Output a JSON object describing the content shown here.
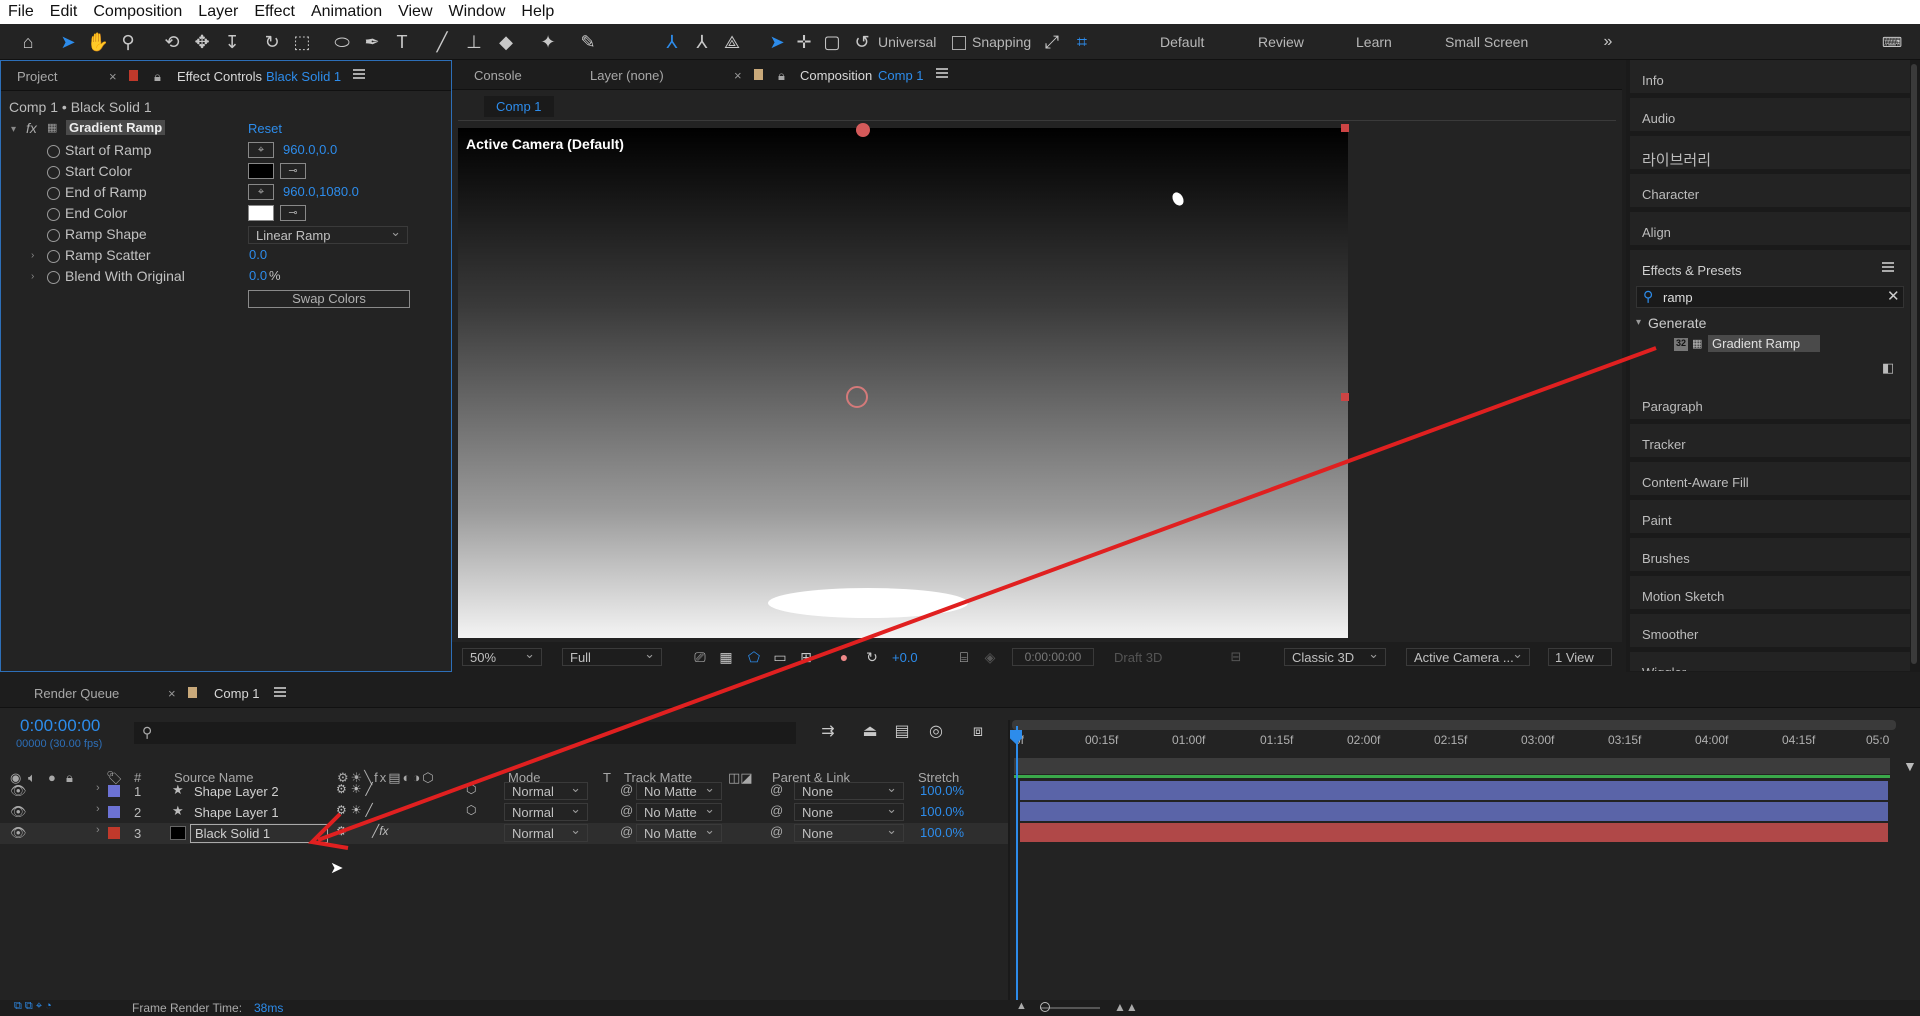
{
  "menu": [
    "File",
    "Edit",
    "Composition",
    "Layer",
    "Effect",
    "Animation",
    "View",
    "Window",
    "Help"
  ],
  "toolbar": {
    "axis_mode": "Universal",
    "snapping": "Snapping",
    "workspaces": [
      "Default",
      "Review",
      "Learn",
      "Small Screen"
    ]
  },
  "left_panel": {
    "tab_project": "Project",
    "tab_effect_controls": "Effect Controls",
    "tab_effect_target": "Black Solid 1",
    "header": "Comp 1 • Black Solid 1",
    "effect_name": "Gradient Ramp",
    "reset": "Reset",
    "fx": "fx",
    "props": [
      {
        "label": "Start of Ramp",
        "value": "960.0,0.0"
      },
      {
        "label": "Start Color",
        "value": ""
      },
      {
        "label": "End of Ramp",
        "value": "960.0,1080.0"
      },
      {
        "label": "End Color",
        "value": ""
      },
      {
        "label": "Ramp Shape",
        "value": "Linear Ramp"
      },
      {
        "label": "Ramp Scatter",
        "value": "0.0"
      },
      {
        "label": "Blend With Original",
        "value": "0.0",
        "unit": "%"
      }
    ],
    "swap": "Swap Colors",
    "colors": {
      "start": "#000000",
      "end": "#ffffff"
    }
  },
  "viewer": {
    "tab_console": "Console",
    "tab_layer": "Layer (none)",
    "tab_composition": "Composition",
    "tab_comp_name": "Comp 1",
    "breadcrumb": "Comp 1",
    "camera_label": "Active Camera (Default)",
    "zoom": "50%",
    "resolution": "Full",
    "exposure": "+0.0",
    "timecode": "0:00:00:00",
    "draft": "Draft 3D",
    "renderer": "Classic 3D",
    "view_camera": "Active Camera ...",
    "views": "1 View"
  },
  "right_panel": {
    "items_top": [
      "Info",
      "Audio",
      "라이브러리",
      "Character",
      "Align"
    ],
    "effects_presets": "Effects & Presets",
    "search_value": "ramp",
    "category": "Generate",
    "result": "Gradient Ramp",
    "result_badge": "32",
    "items_bottom": [
      "Paragraph",
      "Tracker",
      "Content-Aware Fill",
      "Paint",
      "Brushes",
      "Motion Sketch",
      "Smoother",
      "Wiggler"
    ]
  },
  "timeline": {
    "tab_render_queue": "Render Queue",
    "tab_comp": "Comp 1",
    "timecode": "0:00:00:00",
    "fps": "00000 (30.00 fps)",
    "columns": {
      "num": "#",
      "source": "Source Name",
      "mode": "Mode",
      "t": "T",
      "track_matte": "Track Matte",
      "parent": "Parent & Link",
      "stretch": "Stretch"
    },
    "layers": [
      {
        "num": "1",
        "name": "Shape Layer 2",
        "mode": "Normal",
        "matte": "No Matte",
        "parent": "None",
        "stretch": "100.0%",
        "color": "#6c72d4",
        "bar": "#5a64a8"
      },
      {
        "num": "2",
        "name": "Shape Layer 1",
        "mode": "Normal",
        "matte": "No Matte",
        "parent": "None",
        "stretch": "100.0%",
        "color": "#6c72d4",
        "bar": "#5a64a8"
      },
      {
        "num": "3",
        "name": "Black Solid 1",
        "mode": "Normal",
        "matte": "No Matte",
        "parent": "None",
        "stretch": "100.0%",
        "color": "#c0392b",
        "bar": "#b04848"
      }
    ],
    "ruler": [
      "0f",
      "00:15f",
      "01:00f",
      "01:15f",
      "02:00f",
      "02:15f",
      "03:00f",
      "03:15f",
      "04:00f",
      "04:15f",
      "05:0"
    ],
    "render_time_label": "Frame Render Time:",
    "render_time": "38ms"
  }
}
